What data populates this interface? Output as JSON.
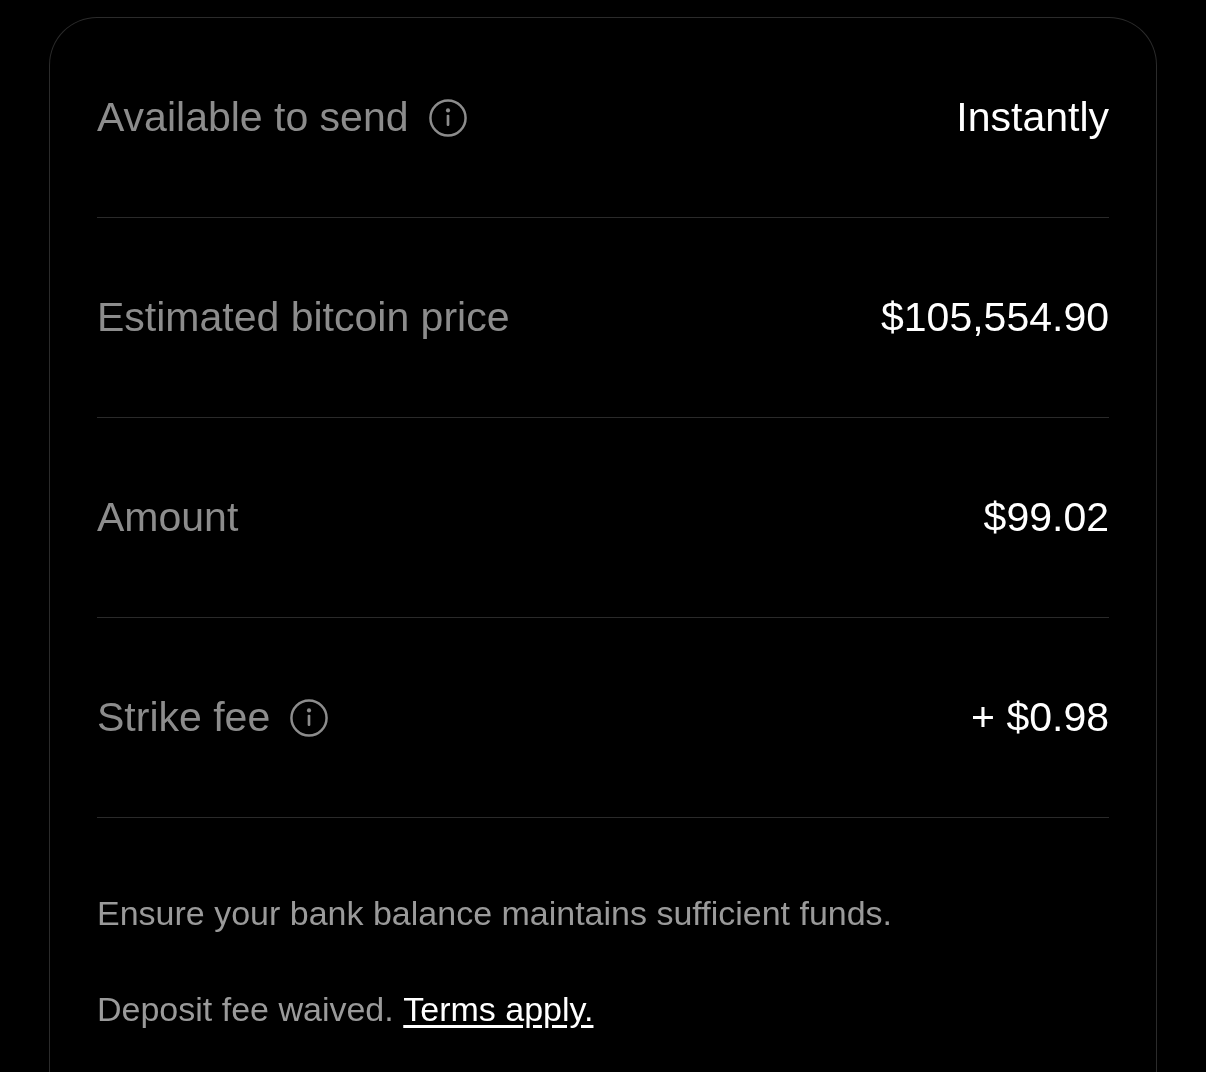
{
  "rows": [
    {
      "label": "Available to send",
      "info": true,
      "value": "Instantly"
    },
    {
      "label": "Estimated bitcoin price",
      "info": false,
      "value": "$105,554.90"
    },
    {
      "label": "Amount",
      "info": false,
      "value": "$99.02"
    },
    {
      "label": "Strike fee",
      "info": true,
      "value": "+ $0.98"
    }
  ],
  "notes": [
    {
      "text": "Ensure your bank balance maintains sufficient funds."
    },
    {
      "text": "Deposit fee waived.",
      "link": "Terms apply."
    }
  ]
}
